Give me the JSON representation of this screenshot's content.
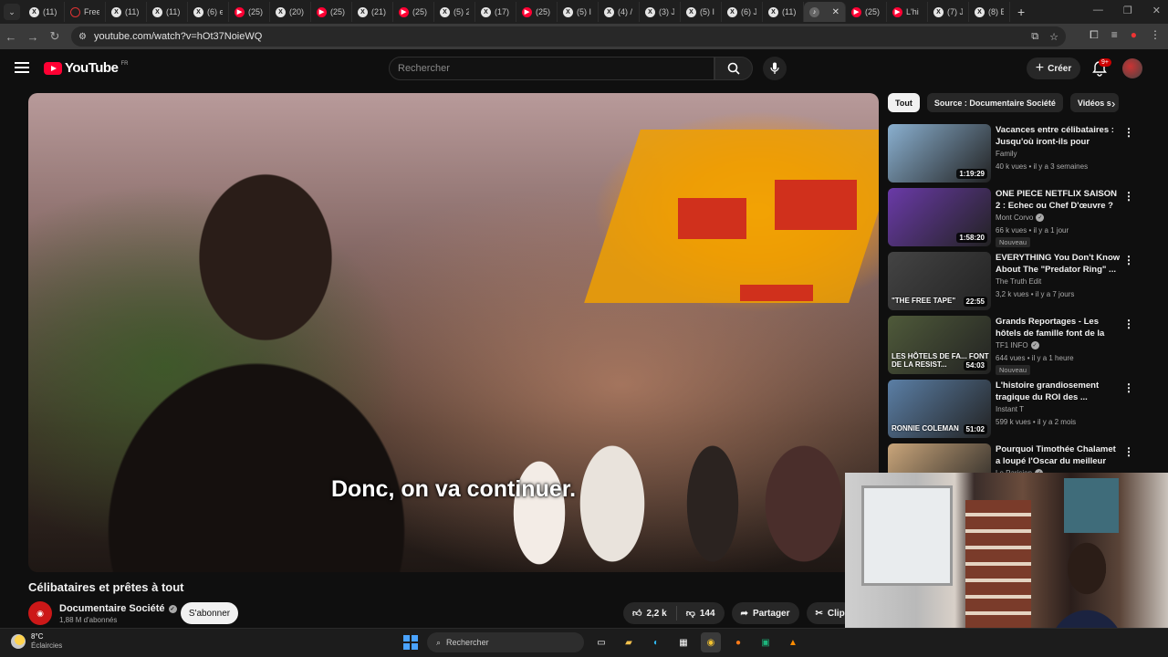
{
  "browser": {
    "tabs": [
      {
        "icon": "x",
        "label": "(11)"
      },
      {
        "icon": "ring",
        "label": "Free"
      },
      {
        "icon": "x",
        "label": "(11)"
      },
      {
        "icon": "x",
        "label": "(11)"
      },
      {
        "icon": "x",
        "label": "(6) e"
      },
      {
        "icon": "yt",
        "label": "(25)"
      },
      {
        "icon": "x",
        "label": "(20)"
      },
      {
        "icon": "yt",
        "label": "(25)"
      },
      {
        "icon": "x",
        "label": "(21)"
      },
      {
        "icon": "yt",
        "label": "(25)"
      },
      {
        "icon": "x",
        "label": "(5) 2"
      },
      {
        "icon": "x",
        "label": "(17)"
      },
      {
        "icon": "yt",
        "label": "(25)"
      },
      {
        "icon": "x",
        "label": "(5) I"
      },
      {
        "icon": "x",
        "label": "(4) /"
      },
      {
        "icon": "x",
        "label": "(3) J"
      },
      {
        "icon": "x",
        "label": "(5) I"
      },
      {
        "icon": "x",
        "label": "(6) J"
      },
      {
        "icon": "x",
        "label": "(11)"
      },
      {
        "icon": "vol",
        "label": "",
        "active": true
      },
      {
        "icon": "yt",
        "label": "(25)"
      },
      {
        "icon": "yt",
        "label": "L'hi"
      },
      {
        "icon": "x",
        "label": "(7) J"
      },
      {
        "icon": "x",
        "label": "(8) E"
      }
    ],
    "url": "youtube.com/watch?v=hOt37NoieWQ"
  },
  "youtube": {
    "logo_text": "YouTube",
    "country": "FR",
    "search_placeholder": "Rechercher",
    "create_label": "Créer",
    "notif_count": "9+"
  },
  "video": {
    "subtitle": "Donc, on va continuer.",
    "title": "Célibataires et prêtes à tout",
    "channel": "Documentaire Société",
    "subscribers": "1,88 M d'abonnés",
    "subscribe_label": "S'abonner",
    "likes": "2,2 k",
    "dislikes": "144",
    "share_label": "Partager",
    "clip_label": "Clip"
  },
  "chips": [
    "Tout",
    "Source : Documentaire Société",
    "Vidéos s"
  ],
  "recommendations": [
    {
      "title": "Vacances entre célibataires : Jusqu'où iront-ils pour trouver ...",
      "channel": "Family",
      "verified": false,
      "meta": "40 k vues • il y a 3 semaines",
      "duration": "1:19:29",
      "badge": "",
      "thumb_text": "",
      "thumb_color": "#8ab0d0"
    },
    {
      "title": "ONE PIECE NETFLIX SAISON 2 : Echec ou Chef D'œuvre ? ...",
      "channel": "Mont Corvo",
      "verified": true,
      "meta": "66 k vues • il y a 1 jour",
      "duration": "1:58:20",
      "badge": "Nouveau",
      "thumb_text": "",
      "thumb_color": "#6a3aa8"
    },
    {
      "title": "EVERYTHING You Don't Know About The \"Predator Ring\" ...",
      "channel": "The Truth Edit",
      "verified": false,
      "meta": "3,2 k vues • il y a 7 jours",
      "duration": "22:55",
      "badge": "",
      "thumb_text": "\"THE FREE TAPE\"",
      "thumb_color": "#444"
    },
    {
      "title": "Grands Reportages - Les hôtels de famille font de la résistanc...",
      "channel": "TF1 INFO",
      "verified": true,
      "meta": "644 vues • il y a 1 heure",
      "duration": "54:03",
      "badge": "Nouveau",
      "thumb_text": "LES HÔTELS DE FA... FONT DE LA RESIST...",
      "thumb_color": "#4f5a3a"
    },
    {
      "title": "L'histoire grandiosement tragique du ROI des ...",
      "channel": "Instant T",
      "verified": false,
      "meta": "599 k vues • il y a 2 mois",
      "duration": "51:02",
      "badge": "",
      "thumb_text": "RONNIE COLEMAN",
      "thumb_color": "#5b7fa6"
    },
    {
      "title": "Pourquoi Timothée Chalamet a loupé l'Oscar du meilleur acteur",
      "channel": "Le Parisien",
      "verified": true,
      "meta": "",
      "duration": "",
      "badge": "",
      "thumb_text": "",
      "thumb_color": "#c9a57a"
    }
  ],
  "taskbar": {
    "temp": "8°C",
    "weather": "Éclaircies",
    "search_label": "Rechercher"
  }
}
